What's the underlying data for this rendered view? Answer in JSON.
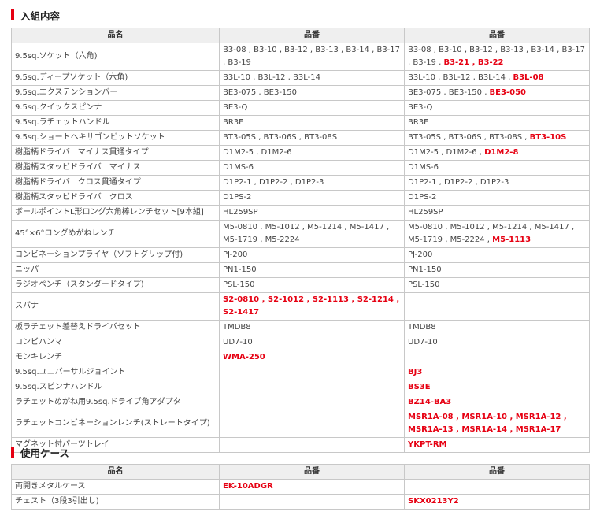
{
  "sections": [
    {
      "title": "入組内容",
      "headers": [
        "品名",
        "品番",
        "品番"
      ],
      "rows": [
        {
          "name": "9.5sq.ソケット（六角)",
          "col2": [
            {
              "t": "B3-08 , B3-10 , B3-12 , B3-13 , B3-14 , B3-17 , B3-19",
              "red": false
            }
          ],
          "col3": [
            {
              "t": "B3-08 , B3-10 , B3-12 , B3-13 , B3-14 , B3-17 , B3-19 , ",
              "red": false
            },
            {
              "t": "B3-21 , B3-22",
              "red": true
            }
          ]
        },
        {
          "name": "9.5sq.ディープソケット（六角)",
          "col2": [
            {
              "t": "B3L-10 , B3L-12 , B3L-14",
              "red": false
            }
          ],
          "col3": [
            {
              "t": "B3L-10 , B3L-12 , B3L-14 , ",
              "red": false
            },
            {
              "t": "B3L-08",
              "red": true
            }
          ]
        },
        {
          "name": "9.5sq.エクステンションバー",
          "col2": [
            {
              "t": "BE3-075 , BE3-150",
              "red": false
            }
          ],
          "col3": [
            {
              "t": "BE3-075 , BE3-150 , ",
              "red": false
            },
            {
              "t": "BE3-050",
              "red": true
            }
          ]
        },
        {
          "name": "9.5sq.クイックスピンナ",
          "col2": [
            {
              "t": "BE3-Q",
              "red": false
            }
          ],
          "col3": [
            {
              "t": "BE3-Q",
              "red": false
            }
          ]
        },
        {
          "name": "9.5sq.ラチェットハンドル",
          "col2": [
            {
              "t": "BR3E",
              "red": false
            }
          ],
          "col3": [
            {
              "t": "BR3E",
              "red": false
            }
          ]
        },
        {
          "name": "9.5sq.ショートヘキサゴンビットソケット",
          "col2": [
            {
              "t": "BT3-05S , BT3-06S , BT3-08S",
              "red": false
            }
          ],
          "col3": [
            {
              "t": "BT3-05S , BT3-06S , BT3-08S , ",
              "red": false
            },
            {
              "t": "BT3-10S",
              "red": true
            }
          ]
        },
        {
          "name": "樹脂柄ドライバ　マイナス貫通タイプ",
          "col2": [
            {
              "t": "D1M2-5 , D1M2-6",
              "red": false
            }
          ],
          "col3": [
            {
              "t": "D1M2-5 , D1M2-6 , ",
              "red": false
            },
            {
              "t": "D1M2-8",
              "red": true
            }
          ]
        },
        {
          "name": "樹脂柄スタッビドライバ　マイナス",
          "col2": [
            {
              "t": "D1MS-6",
              "red": false
            }
          ],
          "col3": [
            {
              "t": "D1MS-6",
              "red": false
            }
          ]
        },
        {
          "name": "樹脂柄ドライバ　クロス貫通タイプ",
          "col2": [
            {
              "t": "D1P2-1 , D1P2-2 , D1P2-3",
              "red": false
            }
          ],
          "col3": [
            {
              "t": "D1P2-1 , D1P2-2 , D1P2-3",
              "red": false
            }
          ]
        },
        {
          "name": "樹脂柄スタッビドライバ　クロス",
          "col2": [
            {
              "t": "D1PS-2",
              "red": false
            }
          ],
          "col3": [
            {
              "t": "D1PS-2",
              "red": false
            }
          ]
        },
        {
          "name": "ボールポイントL形ロング六角棒レンチセット[9本組]",
          "col2": [
            {
              "t": "HL259SP",
              "red": false
            }
          ],
          "col3": [
            {
              "t": "HL259SP",
              "red": false
            }
          ]
        },
        {
          "name": "45°×6°ロングめがねレンチ",
          "col2": [
            {
              "t": "M5-0810 , M5-1012 , M5-1214 , M5-1417 , M5-1719 , M5-2224",
              "red": false
            }
          ],
          "col3": [
            {
              "t": "M5-0810 , M5-1012 , M5-1214 , M5-1417 , M5-1719 , M5-2224 , ",
              "red": false
            },
            {
              "t": "M5-1113",
              "red": true
            }
          ]
        },
        {
          "name": "コンビネーションプライヤ（ソフトグリップ付)",
          "col2": [
            {
              "t": "PJ-200",
              "red": false
            }
          ],
          "col3": [
            {
              "t": "PJ-200",
              "red": false
            }
          ]
        },
        {
          "name": "ニッパ",
          "col2": [
            {
              "t": "PN1-150",
              "red": false
            }
          ],
          "col3": [
            {
              "t": "PN1-150",
              "red": false
            }
          ]
        },
        {
          "name": "ラジオペンチ（スタンダードタイプ)",
          "col2": [
            {
              "t": "PSL-150",
              "red": false
            }
          ],
          "col3": [
            {
              "t": "PSL-150",
              "red": false
            }
          ]
        },
        {
          "name": "スパナ",
          "col2": [
            {
              "t": "S2-0810 , S2-1012 , S2-1113 , S2-1214 , S2-1417",
              "red": true
            }
          ],
          "col3": []
        },
        {
          "name": "板ラチェット差替えドライバセット",
          "col2": [
            {
              "t": "TMDB8",
              "red": false
            }
          ],
          "col3": [
            {
              "t": "TMDB8",
              "red": false
            }
          ]
        },
        {
          "name": "コンビハンマ",
          "col2": [
            {
              "t": "UD7-10",
              "red": false
            }
          ],
          "col3": [
            {
              "t": "UD7-10",
              "red": false
            }
          ]
        },
        {
          "name": "モンキレンチ",
          "col2": [
            {
              "t": "WMA-250",
              "red": true
            }
          ],
          "col3": []
        },
        {
          "name": "9.5sq.ユニバーサルジョイント",
          "col2": [],
          "col3": [
            {
              "t": "BJ3",
              "red": true
            }
          ]
        },
        {
          "name": "9.5sq.スピンナハンドル",
          "col2": [],
          "col3": [
            {
              "t": "BS3E",
              "red": true
            }
          ]
        },
        {
          "name": "ラチェットめがね用9.5sq.ドライブ角アダプタ",
          "col2": [],
          "col3": [
            {
              "t": "BZ14-BA3",
              "red": true
            }
          ]
        },
        {
          "name": "ラチェットコンビネーションレンチ(ストレートタイプ)",
          "col2": [],
          "col3": [
            {
              "t": "MSR1A-08 , MSR1A-10 , MSR1A-12 , MSR1A-13 , MSR1A-14 , MSR1A-17",
              "red": true
            }
          ]
        },
        {
          "name": "マグネット付パーツトレイ",
          "col2": [],
          "col3": [
            {
              "t": "YKPT-RM",
              "red": true
            }
          ]
        }
      ]
    },
    {
      "title": "使用ケース",
      "headers": [
        "品名",
        "品番",
        "品番"
      ],
      "rows": [
        {
          "name": "両開きメタルケース",
          "col2": [
            {
              "t": "EK-10ADGR",
              "red": true
            }
          ],
          "col3": []
        },
        {
          "name": "チェスト（3段3引出し)",
          "col2": [],
          "col3": [
            {
              "t": "SKX0213Y2",
              "red": true
            }
          ]
        }
      ]
    }
  ],
  "colors": {
    "accent_red": "#e60012",
    "header_bg": "#efefef",
    "border": "#c8c8c8"
  }
}
